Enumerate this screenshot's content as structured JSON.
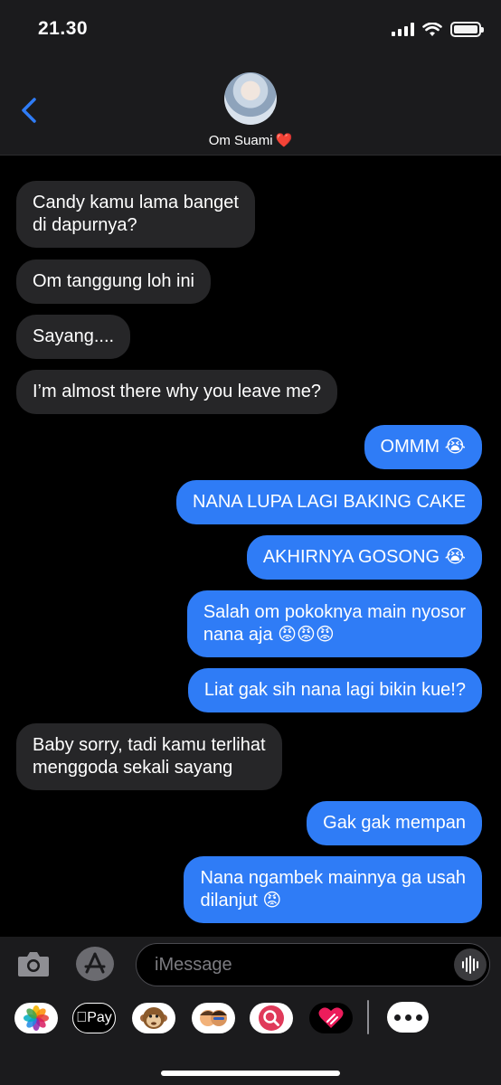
{
  "status_bar": {
    "time": "21.30"
  },
  "header": {
    "contact_name": "Om Suami",
    "contact_emoji": "❤️"
  },
  "messages": [
    {
      "side": "in",
      "text": "Candy kamu lama banget\ndi dapurnya?"
    },
    {
      "side": "in",
      "text": "Om tanggung loh ini"
    },
    {
      "side": "in",
      "text": "Sayang...."
    },
    {
      "side": "in",
      "text": "I’m almost there why you leave me?"
    },
    {
      "side": "out",
      "text": "OMMM 😭"
    },
    {
      "side": "out",
      "text": "NANA LUPA LAGI BAKING CAKE"
    },
    {
      "side": "out",
      "text": "AKHIRNYA GOSONG 😭"
    },
    {
      "side": "out",
      "text": "Salah om pokoknya main nyosor\nnana aja 😡😡😡"
    },
    {
      "side": "out",
      "text": "Liat gak sih nana lagi bikin kue!?"
    },
    {
      "side": "in",
      "text": "Baby sorry, tadi kamu terlihat\nmenggoda sekali sayang"
    },
    {
      "side": "out",
      "text": "Gak gak mempan"
    },
    {
      "side": "out",
      "text": "Nana ngambek mainnya ga usah\ndilanjut 😡"
    }
  ],
  "input": {
    "placeholder": "iMessage"
  },
  "app_drawer": {
    "apps": [
      {
        "icon": "photos-icon",
        "label": ""
      },
      {
        "icon": "apple-pay-icon",
        "label": "Pay"
      },
      {
        "icon": "animoji-monkey-icon",
        "label": ""
      },
      {
        "icon": "memoji-icon",
        "label": ""
      },
      {
        "icon": "image-search-icon",
        "label": ""
      },
      {
        "icon": "digital-touch-icon",
        "label": ""
      }
    ]
  },
  "colors": {
    "outgoing": "#2f7cf6",
    "incoming": "#262628",
    "accent": "#2f7cf6"
  }
}
